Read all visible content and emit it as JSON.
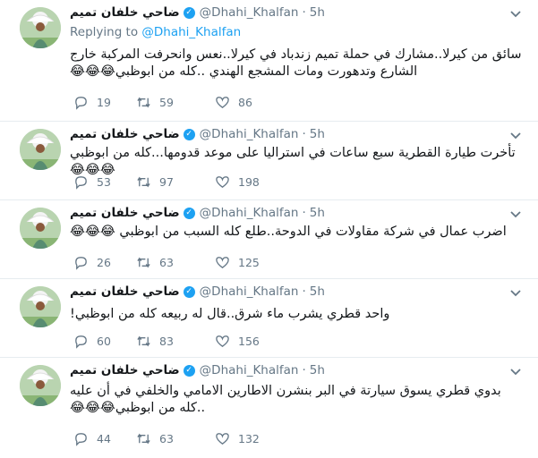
{
  "user": {
    "name": "ضاحي خلفان تميم",
    "handle": "@Dhahi_Khalfan",
    "separator": "·",
    "verified_mark": "✓"
  },
  "reply_context": {
    "prefix": "Replying to",
    "target": "@Dhahi_Khalfan"
  },
  "icons": {
    "reply": "reply-icon",
    "retweet": "retweet-icon",
    "like": "heart-icon",
    "menu": "chevron-down-icon",
    "verified": "verified-badge-icon"
  },
  "colors": {
    "accent": "#1da1f2",
    "muted": "#657786",
    "text": "#14171a",
    "divider": "#e6ecf0"
  },
  "tweets": [
    {
      "time": "5h",
      "text": "سائق من كيرلا..مشارك في حملة تميم زندباد في كيرلا..نعس وانحرفت المركبة خارج الشارع وتدهورت ومات المشجع الهندي ..كله من ابوظبي😂😂😂",
      "replies": "19",
      "retweets": "59",
      "likes": "86"
    },
    {
      "time": "5h",
      "text": "تأخرت طيارة القطرية سبع ساعات في استراليا على موعد قدومها...كله من ابوظبي😂😂😂",
      "replies": "53",
      "retweets": "97",
      "likes": "198"
    },
    {
      "time": "5h",
      "text": "اضرب عمال في شركة مقاولات في الدوحة..طلع كله السبب من ابوظبي 😂😂😂",
      "replies": "26",
      "retweets": "63",
      "likes": "125"
    },
    {
      "time": "5h",
      "text": "واحد قطري يشرب ماء شرق..قال له ربيعه كله من ابوظبي!",
      "replies": "60",
      "retweets": "83",
      "likes": "156"
    },
    {
      "time": "5h",
      "text": "بدوي قطري يسوق سيارتة في البر بنشرن الاطارين الامامي والخلفي في أن عليه ..كله من ابوظبي😂😂😂",
      "replies": "44",
      "retweets": "63",
      "likes": "132"
    }
  ]
}
